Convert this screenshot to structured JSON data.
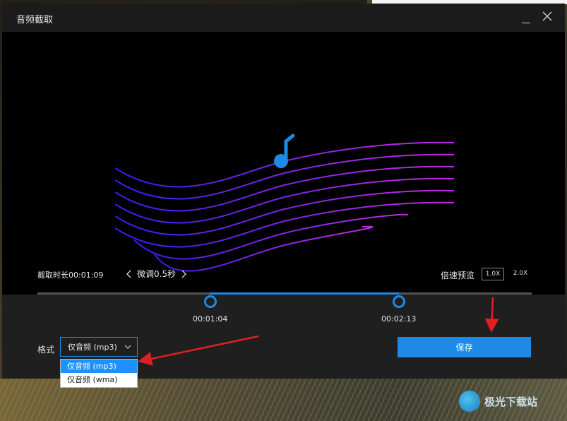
{
  "window": {
    "title": "音频截取"
  },
  "preview": {
    "duration_label": "截取时长00:01:09",
    "fine_tune_label": "微调0.5秒",
    "speed_label": "倍速预览",
    "speed_options": [
      "1.0X",
      "2.0X"
    ],
    "selected_speed": "1.0X"
  },
  "timeline": {
    "start_time": "00:01:04",
    "end_time": "00:02:13"
  },
  "format": {
    "label": "格式",
    "selected": "仅音频 (mp3)",
    "options": [
      "仅音频 (mp3)",
      "仅音频 (wma)"
    ]
  },
  "actions": {
    "save_label": "保存"
  },
  "watermark": {
    "text": "极光下载站"
  },
  "colors": {
    "accent": "#1e8ae8",
    "wave_start": "#3a1cf0",
    "wave_end": "#c12de0",
    "annotation_arrow": "#e02020"
  }
}
